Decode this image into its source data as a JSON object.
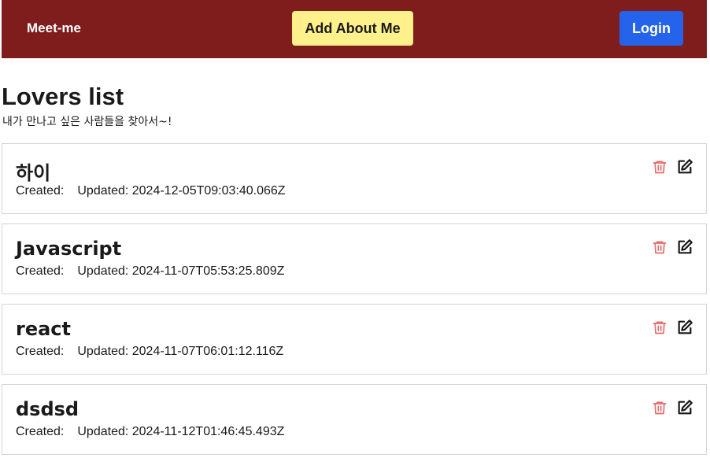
{
  "header": {
    "brand": "Meet-me",
    "about_button": "Add About Me",
    "login_button": "Login"
  },
  "main": {
    "title": "Lovers list",
    "subtitle": "내가 만나고 싶은 사람들을 찾아서~!"
  },
  "cards": [
    {
      "title": "하이",
      "created_label": "Created:",
      "updated": "Updated: 2024-12-05T09:03:40.066Z"
    },
    {
      "title": "Javascript",
      "created_label": "Created:",
      "updated": "Updated: 2024-11-07T05:53:25.809Z"
    },
    {
      "title": "react",
      "created_label": "Created:",
      "updated": "Updated: 2024-11-07T06:01:12.116Z"
    },
    {
      "title": "dsdsd",
      "created_label": "Created:",
      "updated": "Updated: 2024-11-12T01:46:45.493Z"
    }
  ],
  "icons": {
    "delete": "trash-icon",
    "edit": "edit-icon"
  },
  "colors": {
    "navbar": "#7f1d1d",
    "about_button": "#fef08a",
    "login_button": "#2563eb",
    "delete_icon": "#e36b6b",
    "edit_icon": "#1a1a1a",
    "card_border": "#d4d4d4"
  }
}
